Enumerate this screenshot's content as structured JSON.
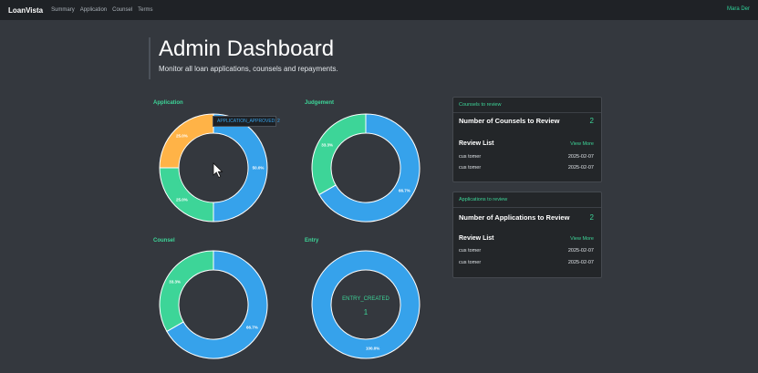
{
  "navbar": {
    "brand": "LoanVista",
    "links": [
      "Summary",
      "Application",
      "Counsel",
      "Terms"
    ],
    "user": "Mara Der"
  },
  "header": {
    "title": "Admin Dashboard",
    "subtitle": "Monitor all loan applications, counsels and repayments."
  },
  "colors": {
    "blue": "#36a2eb",
    "green": "#3dd598",
    "orange": "#ffb347",
    "accent": "#2fd39a",
    "background": "#34383e"
  },
  "charts": [
    {
      "title": "Application",
      "type": "doughnut",
      "slices": [
        {
          "label": "APPLICATION_APPROVED",
          "value": 50.0,
          "pct_label": "50.0%",
          "color": "#36a2eb"
        },
        {
          "label": "",
          "value": 25.0,
          "pct_label": "25.0%",
          "color": "#3dd598"
        },
        {
          "label": "",
          "value": 25.0,
          "pct_label": "25.0%",
          "color": "#ffb347"
        }
      ],
      "tooltip": "APPLICATION_APPROVED: 2"
    },
    {
      "title": "Judgement",
      "type": "doughnut",
      "slices": [
        {
          "value": 66.7,
          "pct_label": "66.7%",
          "color": "#36a2eb"
        },
        {
          "value": 33.3,
          "pct_label": "33.3%",
          "color": "#3dd598"
        }
      ]
    },
    {
      "title": "Counsel",
      "type": "doughnut",
      "slices": [
        {
          "value": 66.7,
          "pct_label": "66.7%",
          "color": "#36a2eb"
        },
        {
          "value": 33.3,
          "pct_label": "33.3%",
          "color": "#3dd598"
        }
      ]
    },
    {
      "title": "Entry",
      "type": "doughnut",
      "slices": [
        {
          "value": 100.0,
          "pct_label": "100.0%",
          "color": "#36a2eb"
        }
      ],
      "center_label": "ENTRY_CREATED",
      "center_value": "1"
    }
  ],
  "counsels_card": {
    "header": "Counsels to review",
    "title": "Number of Counsels to Review",
    "count": "2",
    "list_title": "Review List",
    "view_more": "View More",
    "items": [
      {
        "name": "cus tomer",
        "date": "2025-02-07"
      },
      {
        "name": "cus tomer",
        "date": "2025-02-07"
      }
    ]
  },
  "applications_card": {
    "header": "Applications to review",
    "title": "Number of Applications to Review",
    "count": "2",
    "list_title": "Review List",
    "view_more": "View More",
    "items": [
      {
        "name": "cus tomer",
        "date": "2025-02-07"
      },
      {
        "name": "cus tomer",
        "date": "2025-02-07"
      }
    ]
  }
}
